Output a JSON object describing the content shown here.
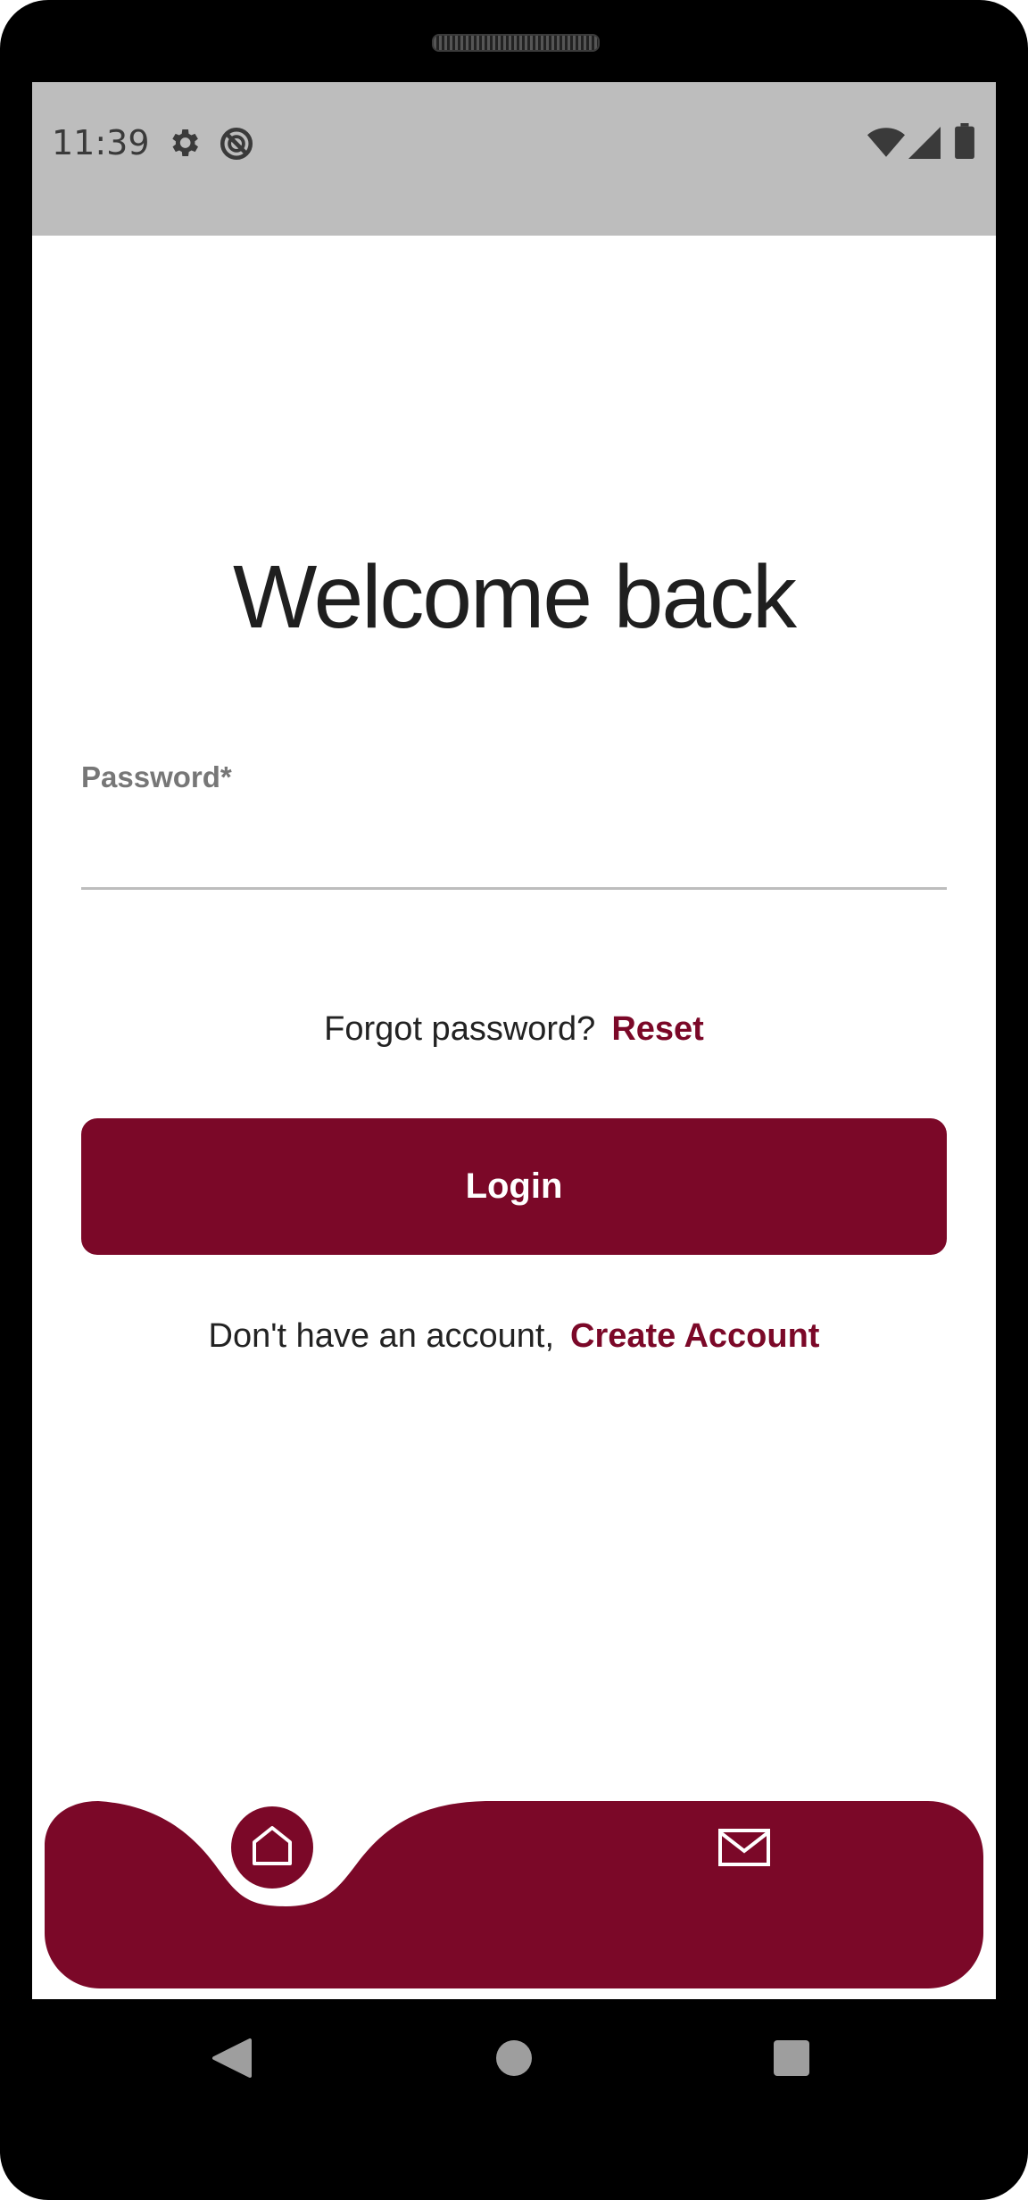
{
  "status_bar": {
    "time": "11:39",
    "left_icons": [
      "gear-icon",
      "do-not-disturb-icon"
    ],
    "right_icons": [
      "wifi-icon",
      "signal-icon",
      "battery-icon"
    ]
  },
  "login": {
    "title": "Welcome back",
    "password_label": "Password*",
    "password_value": "",
    "forgot_text": "Forgot password?",
    "reset_link": "Reset",
    "login_button": "Login",
    "no_account_text": "Don't have an account,",
    "create_account_link": "Create Account"
  },
  "bottom_nav": {
    "items": [
      {
        "icon": "home-icon",
        "active": true
      },
      {
        "icon": "mail-icon",
        "active": false
      }
    ]
  },
  "system_nav": {
    "buttons": [
      "back-icon",
      "home-circle-icon",
      "recents-icon"
    ]
  },
  "colors": {
    "accent": "#7b0828",
    "status_bar": "#bdbdbd",
    "text": "#1f1f1f"
  }
}
